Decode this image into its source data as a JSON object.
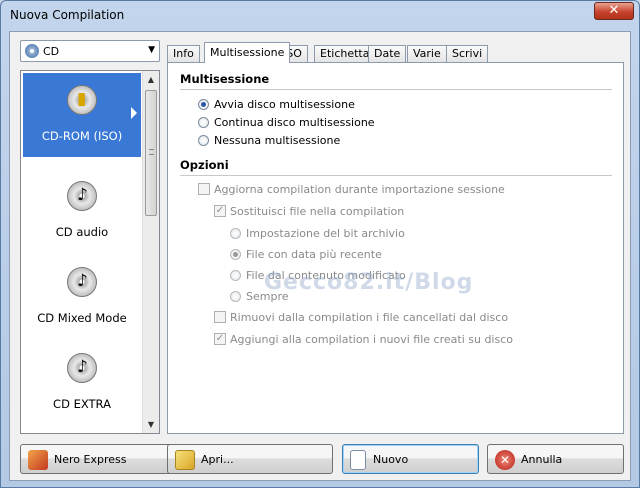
{
  "window": {
    "title": "Nuova Compilation",
    "close_symbol": "✕"
  },
  "disc_type": {
    "value": "CD"
  },
  "modes": [
    {
      "label": "CD-ROM (ISO)",
      "icon": "cd-rom-disc-icon",
      "selected": true
    },
    {
      "label": "CD audio",
      "icon": "cd-audio-disc-icon",
      "selected": false
    },
    {
      "label": "CD Mixed Mode",
      "icon": "cd-mixed-disc-icon",
      "selected": false
    },
    {
      "label": "CD EXTRA",
      "icon": "cd-extra-disc-icon",
      "selected": false
    }
  ],
  "tabs": [
    "Info",
    "Multisessione",
    "ISO",
    "Etichetta",
    "Date",
    "Varie",
    "Scrivi"
  ],
  "active_tab": "Multisessione",
  "multisession": {
    "heading": "Multisessione",
    "options": [
      {
        "label": "Avvia disco multisessione",
        "checked": true
      },
      {
        "label": "Continua disco multisessione",
        "checked": false
      },
      {
        "label": "Nessuna multisessione",
        "checked": false
      }
    ]
  },
  "options": {
    "heading": "Opzioni",
    "update_compilation": {
      "label": "Aggiorna compilation durante importazione sessione",
      "checked": false
    },
    "replace_files": {
      "label": "Sostituisci file nella compilation",
      "checked": true
    },
    "replace_radios": [
      {
        "label": "Impostazione del bit archivio",
        "checked": false
      },
      {
        "label": "File con data più recente",
        "checked": true
      },
      {
        "label": "File dal contenuto modificato",
        "checked": false
      },
      {
        "label": "Sempre",
        "checked": false
      }
    ],
    "remove_deleted": {
      "label": "Rimuovi dalla compilation i file cancellati dal disco",
      "checked": false
    },
    "add_new": {
      "label": "Aggiungi alla compilation i nuovi file creati su disco",
      "checked": true
    }
  },
  "watermark": "Gecco82.it/Blog",
  "buttons": {
    "nero_express": "Nero Express",
    "open": "Apri...",
    "new": "Nuovo",
    "cancel": "Annulla"
  },
  "colors": {
    "selection": "#3a78d6",
    "close": "#c8452f"
  }
}
